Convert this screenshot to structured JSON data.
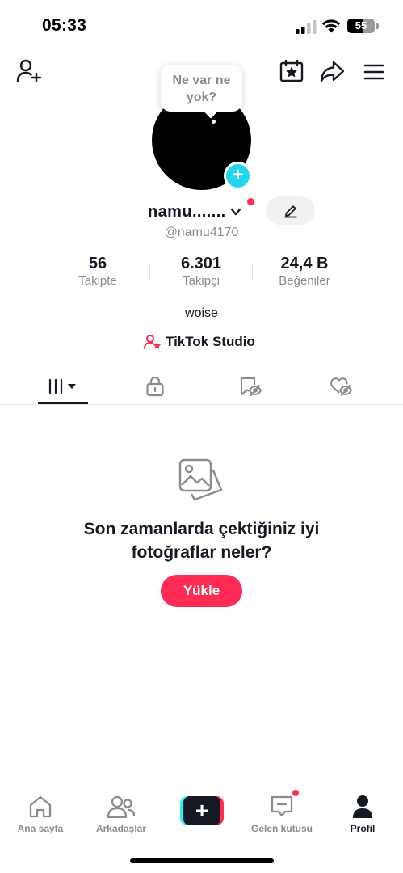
{
  "status": {
    "time": "05:33",
    "battery": "55"
  },
  "tooltip": {
    "line1": "Ne var ne",
    "line2": "yok?"
  },
  "profile": {
    "username": "namu.......",
    "handle": "@namu4170",
    "bio": "woise",
    "studio_label": "TikTok Studio"
  },
  "stats": [
    {
      "value": "56",
      "label": "Takipte"
    },
    {
      "value": "6.301",
      "label": "Takipçi"
    },
    {
      "value": "24,4 B",
      "label": "Beğeniler"
    }
  ],
  "empty_state": {
    "title_line1": "Son zamanlarda çektiğiniz iyi",
    "title_line2": "fotoğraflar neler?",
    "button": "Yükle"
  },
  "bottom_nav": {
    "home": "Ana sayfa",
    "friends": "Arkadaşlar",
    "inbox": "Gelen kutusu",
    "profile": "Profil"
  },
  "colors": {
    "accent": "#fe2c55",
    "cyan": "#20d5ec",
    "text": "#161823",
    "muted": "#8a8b91"
  },
  "icons": {
    "top_left": "add-friend-icon",
    "top_right": [
      "calendar-star-icon",
      "share-icon",
      "menu-icon"
    ],
    "tabs": [
      "grid-icon",
      "lock-icon",
      "bookmark-icon",
      "liked-icon"
    ]
  }
}
